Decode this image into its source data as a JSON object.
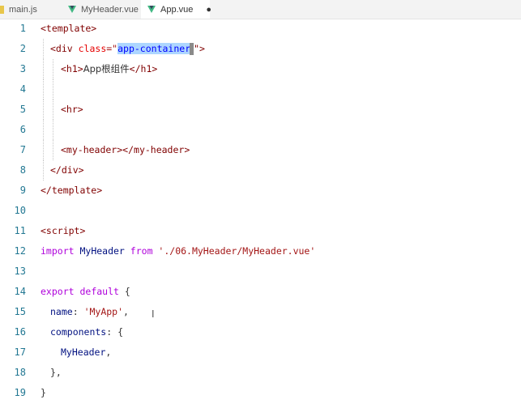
{
  "tabs": [
    {
      "label": "main.js",
      "icon": "js-file-icon",
      "active": false
    },
    {
      "label": "MyHeader.vue",
      "icon": "vue-file-icon",
      "active": false
    },
    {
      "label": "App.vue",
      "icon": "vue-file-icon",
      "active": true,
      "modified_marker": "●"
    }
  ],
  "editor": {
    "line_numbers": [
      "1",
      "2",
      "3",
      "4",
      "5",
      "6",
      "7",
      "8",
      "9",
      "10",
      "11",
      "12",
      "13",
      "14",
      "15",
      "16",
      "17",
      "18",
      "19"
    ],
    "lines": [
      {
        "t1": "<template>"
      },
      {
        "t1": "<div ",
        "t2": "class",
        "t3": "=\"",
        "sel": "app-container",
        "t4": "\">"
      },
      {
        "t1": "<h1>",
        "t2": "App根组件",
        "t3": "</h1>"
      },
      {},
      {
        "t1": "<hr>"
      },
      {},
      {
        "t1": "<my-header>",
        "t2": "</my-header>"
      },
      {
        "t1": "</div>"
      },
      {
        "t1": "</template>"
      },
      {},
      {
        "t1": "<script>"
      },
      {
        "t1": "import",
        "t2": " MyHeader ",
        "t3": "from",
        "t4": " './06.MyHeader/MyHeader.vue'"
      },
      {},
      {
        "t1": "export",
        "t2": " default",
        "t3": " {"
      },
      {
        "t1": "name",
        "t2": ": ",
        "t3": "'MyApp'",
        "t4": ","
      },
      {
        "t1": "components",
        "t2": ": {"
      },
      {
        "t1": "MyHeader",
        "t2": ","
      },
      {
        "t1": "},"
      },
      {
        "t1": "}"
      }
    ]
  }
}
